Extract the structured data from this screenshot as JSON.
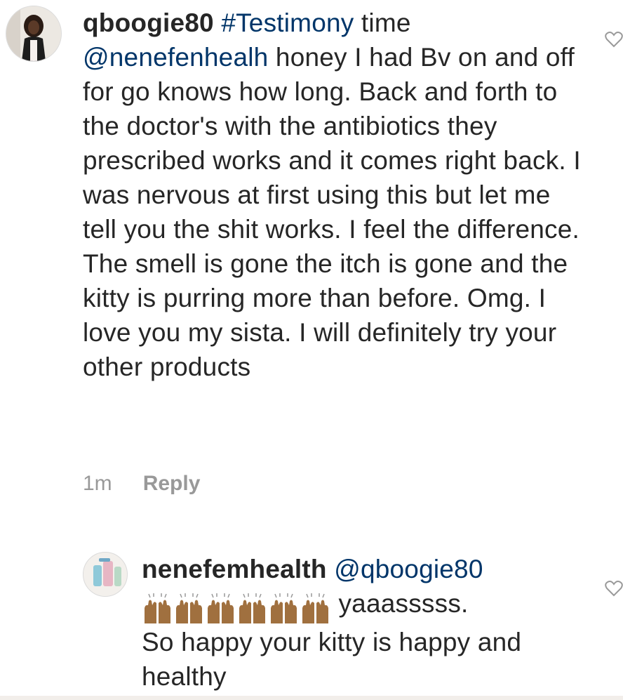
{
  "comments": [
    {
      "username": "qboogie80",
      "hashtag": "#Testimony",
      "word_after_hashtag": " time",
      "mention": "@nenefenhealh",
      "body": " honey I had Bv on and off for go knows how long. Back and forth to the doctor's with the antibiotics they prescribed works and it comes right back. I was nervous at first using this but let me tell you the shit works. I feel the difference. The smell is gone the itch is gone and the kitty is purring more than before. Omg. I love you my sista. I will definitely try your other products",
      "time": "1m",
      "reply_label": "Reply"
    },
    {
      "username": "nenefemhealth",
      "mention": "@qboogie80",
      "emoji": "raising-hands x6",
      "after_emoji": " yaaasssss.",
      "body": "So happy your kitty is happy and healthy"
    }
  ],
  "colors": {
    "text": "#262626",
    "mention": "#003569",
    "meta": "#999999"
  }
}
